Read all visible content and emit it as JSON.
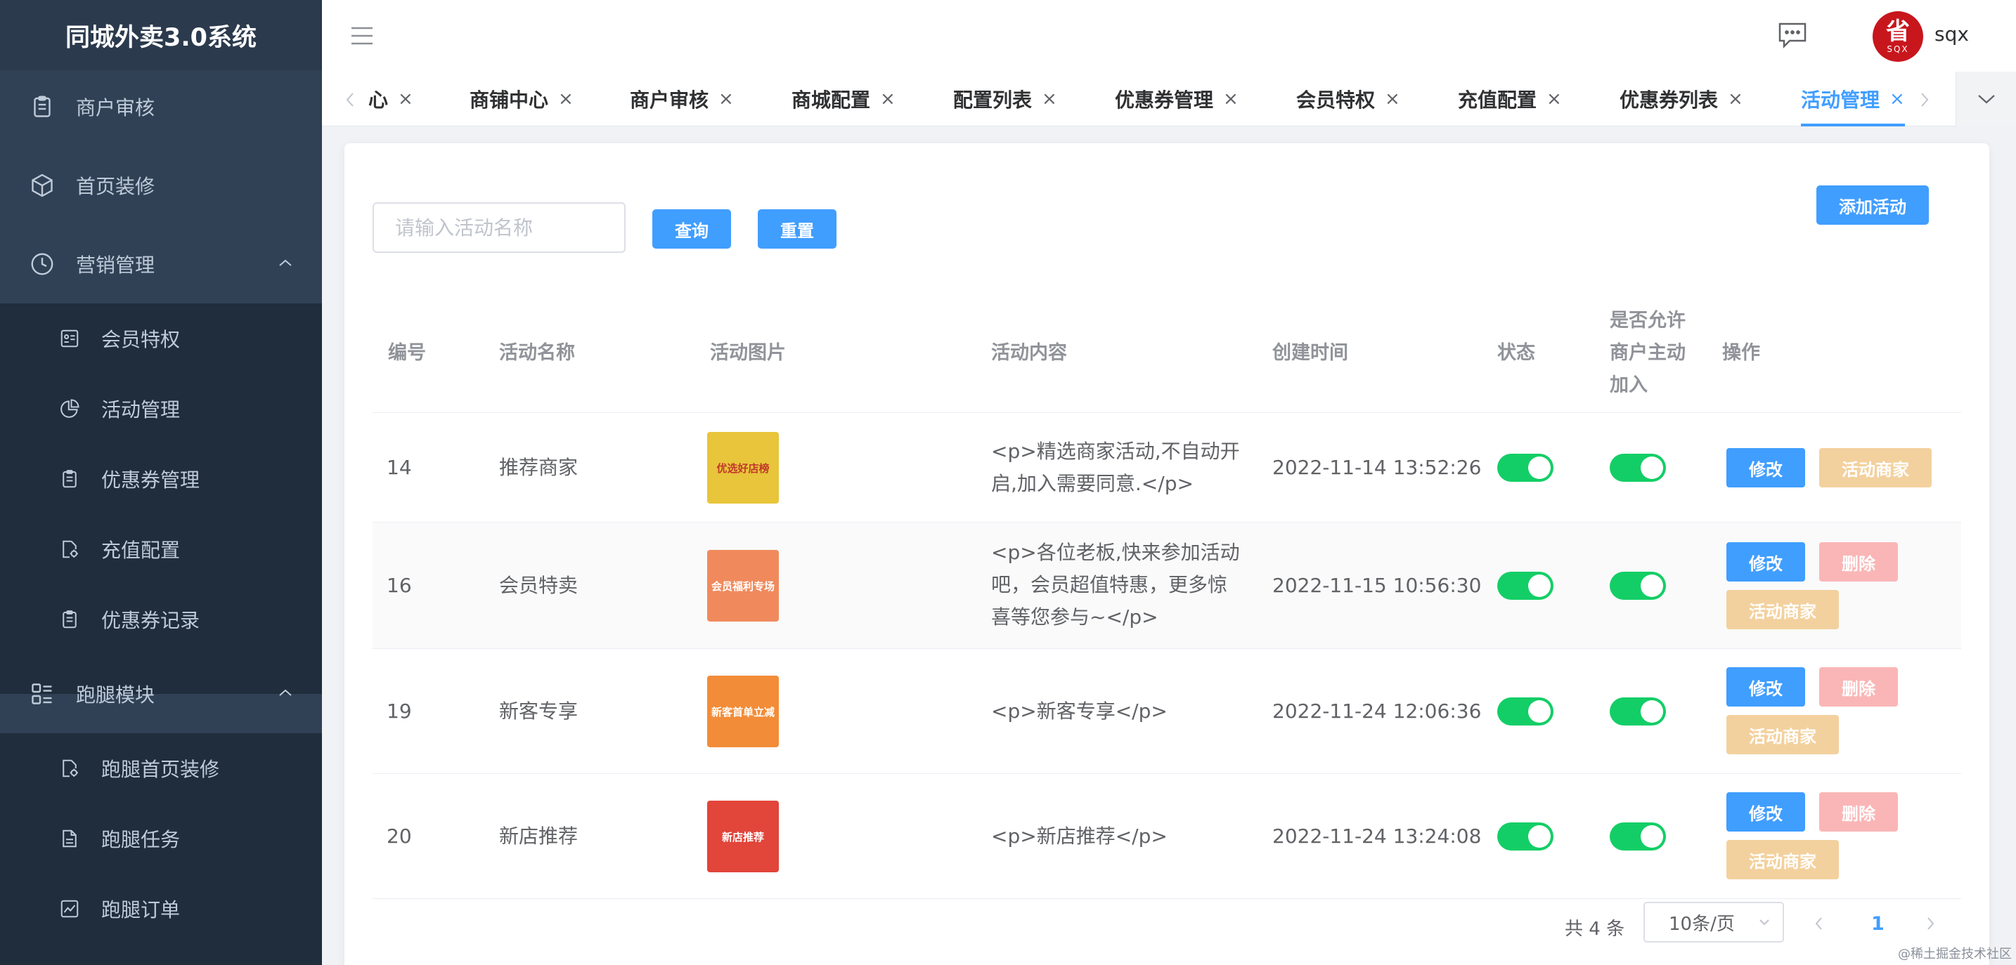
{
  "app": {
    "title": "同城外卖3.0系统"
  },
  "sidebar": {
    "items": [
      {
        "label": "商户审核",
        "icon": "clipboard-icon",
        "level": 1
      },
      {
        "label": "首页装修",
        "icon": "cube-icon",
        "level": 1
      },
      {
        "label": "营销管理",
        "icon": "clock-icon",
        "level": 1,
        "expanded": true
      },
      {
        "label": "会员特权",
        "icon": "id-card-icon",
        "level": 2
      },
      {
        "label": "活动管理",
        "icon": "pie-chart-icon",
        "level": 2
      },
      {
        "label": "优惠券管理",
        "icon": "clipboard-icon",
        "level": 2
      },
      {
        "label": "充值配置",
        "icon": "document-gear-icon",
        "level": 2
      },
      {
        "label": "优惠券记录",
        "icon": "clipboard-icon",
        "level": 2
      },
      {
        "label": "跑腿模块",
        "icon": "list-grid-icon",
        "level": 1,
        "expanded": true
      },
      {
        "label": "跑腿首页装修",
        "icon": "document-gear-icon",
        "level": 2
      },
      {
        "label": "跑腿任务",
        "icon": "document-icon",
        "level": 2
      },
      {
        "label": "跑腿订单",
        "icon": "line-chart-icon",
        "level": 2
      }
    ]
  },
  "header": {
    "username": "sqx",
    "avatar_text": "省",
    "avatar_subtext": "SQX"
  },
  "tabs": [
    {
      "label": "心",
      "active": false
    },
    {
      "label": "商铺中心",
      "active": false
    },
    {
      "label": "商户审核",
      "active": false
    },
    {
      "label": "商城配置",
      "active": false
    },
    {
      "label": "配置列表",
      "active": false
    },
    {
      "label": "优惠券管理",
      "active": false
    },
    {
      "label": "会员特权",
      "active": false
    },
    {
      "label": "充值配置",
      "active": false
    },
    {
      "label": "优惠券列表",
      "active": false
    },
    {
      "label": "活动管理",
      "active": true
    }
  ],
  "toolbar": {
    "search_placeholder": "请输入活动名称",
    "query_label": "查询",
    "reset_label": "重置",
    "add_label": "添加活动"
  },
  "table": {
    "headers": {
      "id": "编号",
      "name": "活动名称",
      "image": "活动图片",
      "content": "活动内容",
      "created": "创建时间",
      "status": "状态",
      "allow_line1": "是否允许",
      "allow_line2": "商户主动",
      "allow_line3": "加入",
      "actions": "操作"
    },
    "rows": [
      {
        "id": "14",
        "name": "推荐商家",
        "content_line1": "<p>精选商家活动,不自动开",
        "content_line2": "启,加入需要同意.</p>",
        "content_line3": "",
        "created": "2022-11-14 13:52:26",
        "status": true,
        "allow": true,
        "img_text": "优选好店榜",
        "img_color": "#e8c53a"
      },
      {
        "id": "16",
        "name": "会员特卖",
        "content_line1": "<p>各位老板,快来参加活动",
        "content_line2": "吧，会员超值特惠，更多惊",
        "content_line3": "喜等您参与~</p>",
        "created": "2022-11-15 10:56:30",
        "status": true,
        "allow": true,
        "img_text": "会员福利专场",
        "img_color": "#f08a5d"
      },
      {
        "id": "19",
        "name": "新客专享",
        "content_line1": "<p>新客专享</p>",
        "content_line2": "",
        "content_line3": "",
        "created": "2022-11-24 12:06:36",
        "status": true,
        "allow": true,
        "img_text": "新客首单立减",
        "img_color": "#f28c38"
      },
      {
        "id": "20",
        "name": "新店推荐",
        "content_line1": "<p>新店推荐</p>",
        "content_line2": "",
        "content_line3": "",
        "created": "2022-11-24 13:24:08",
        "status": true,
        "allow": true,
        "img_text": "新店推荐",
        "img_color": "#e2453a"
      }
    ],
    "actions": {
      "edit": "修改",
      "delete": "删除",
      "merchants": "活动商家"
    }
  },
  "pagination": {
    "total_label": "共 4 条",
    "page_size": "10条/页",
    "current_page": "1"
  },
  "watermark": "@稀土掘金技术社区",
  "colors": {
    "sidebar_bg": "#304156",
    "primary": "#409eff",
    "switch_on": "#13ce66",
    "danger_light": "#fab6b6",
    "warning_light": "#f3d19e"
  }
}
